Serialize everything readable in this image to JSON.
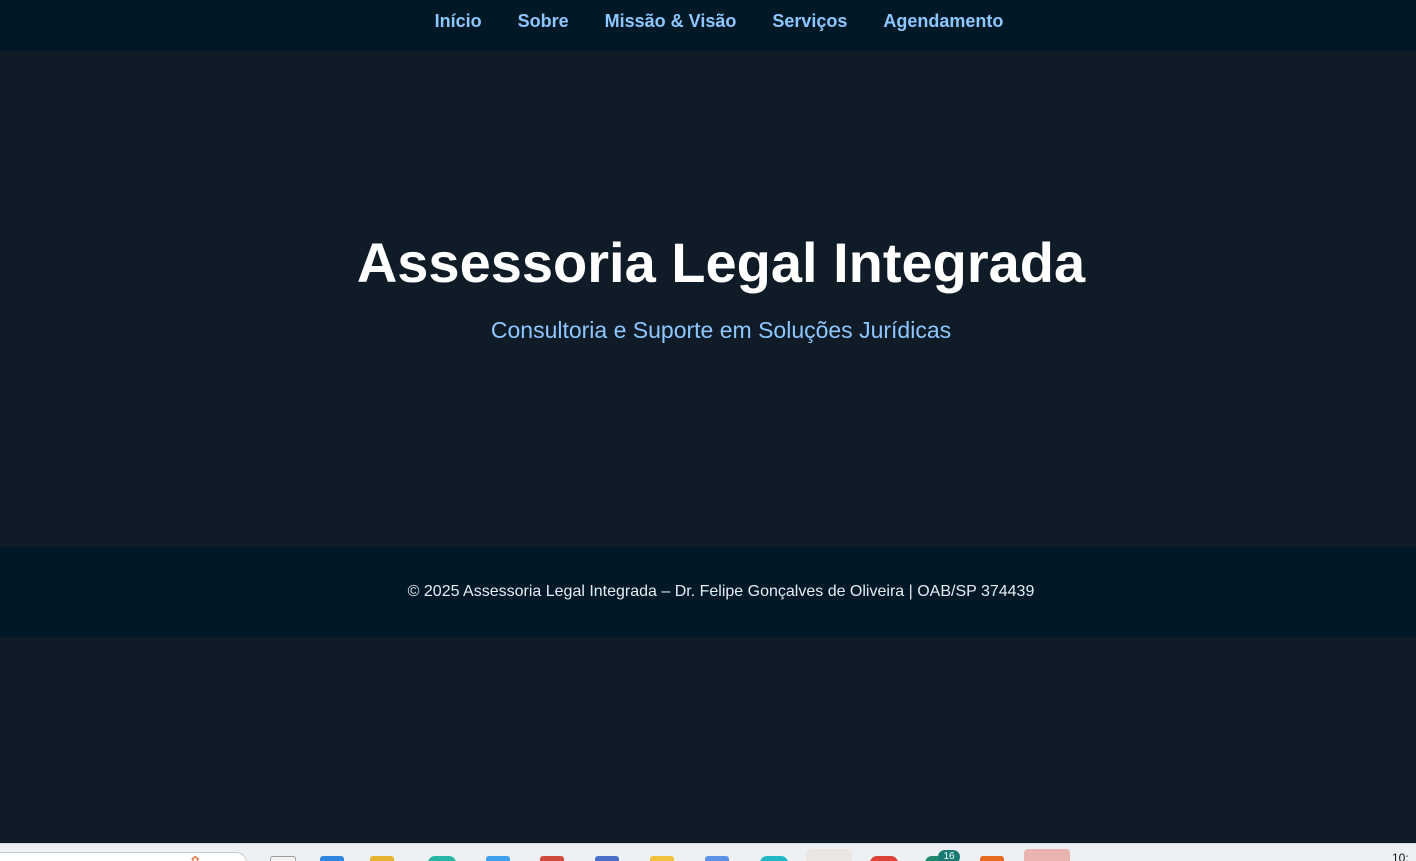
{
  "nav": {
    "items": [
      {
        "label": "Início"
      },
      {
        "label": "Sobre"
      },
      {
        "label": "Missão & Visão"
      },
      {
        "label": "Serviços"
      },
      {
        "label": "Agendamento"
      }
    ]
  },
  "hero": {
    "title": "Assessoria Legal Integrada",
    "subtitle": "Consultoria e Suporte em Soluções Jurídicas"
  },
  "footer": {
    "text": "© 2025 Assessoria Legal Integrada – Dr. Felipe Gonçalves de Oliveira | OAB/SP 374439"
  },
  "taskbar": {
    "badge_count": "16",
    "clock": "10:"
  },
  "colors": {
    "page_background": "#0f1b27",
    "nav_background": "#011826",
    "nav_link": "#8ec7ff",
    "title": "#ffffff",
    "subtitle": "#8ec7ff",
    "footer_text": "#e6ecf2"
  }
}
